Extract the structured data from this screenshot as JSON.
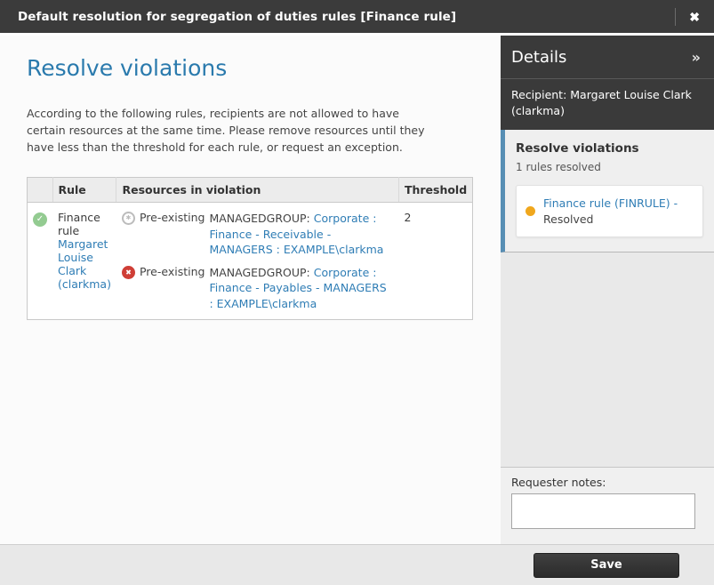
{
  "icons": {
    "close": "✖",
    "collapse": "»",
    "check": "✓",
    "disabled_remove": "✱",
    "remove": "✖"
  },
  "colors": {
    "titlebar_bg": "#3b3b3b",
    "heading_blue": "#2a7aad",
    "link_blue": "#2f7db5",
    "accent_border_blue": "#578eb4",
    "resolved_green": "#93cb91",
    "remove_red": "#cf3e36",
    "pending_dot_orange": "#f0a71d"
  },
  "titlebar": {
    "title": "Default resolution for segregation of duties rules [Finance rule]"
  },
  "main": {
    "heading": "Resolve violations",
    "description": "According to the following rules, recipients are not allowed to have certain resources at the same time. Please remove resources until they have less than the threshold for each rule, or request an exception.",
    "table": {
      "headers": {
        "status": "",
        "rule": "Rule",
        "resources": "Resources in violation",
        "threshold": "Threshold"
      },
      "row": {
        "rule_name": "Finance rule",
        "rule_link": "Margaret Louise Clark (clarkma)",
        "threshold": "2",
        "resources": [
          {
            "icon": "disabled-remove-icon",
            "state": "Pre-existing",
            "type_label": "MANAGEDGROUP:",
            "link": "Corporate : Finance - Receivable - MANAGERS : EXAMPLE\\clarkma"
          },
          {
            "icon": "remove-icon",
            "state": "Pre-existing",
            "type_label": "MANAGEDGROUP:",
            "link": "Corporate : Finance - Payables - MANAGERS : EXAMPLE\\clarkma"
          }
        ]
      }
    }
  },
  "sidebar": {
    "details_title": "Details",
    "recipient": "Recipient: Margaret Louise Clark (clarkma)",
    "section_title": "Resolve violations",
    "section_subtitle": "1 rules resolved",
    "rule_status_link": "Finance rule (FINRULE) -",
    "rule_status_suffix": "Resolved",
    "notes_label": "Requester notes:",
    "notes_value": ""
  },
  "footer": {
    "save_label": "Save"
  }
}
